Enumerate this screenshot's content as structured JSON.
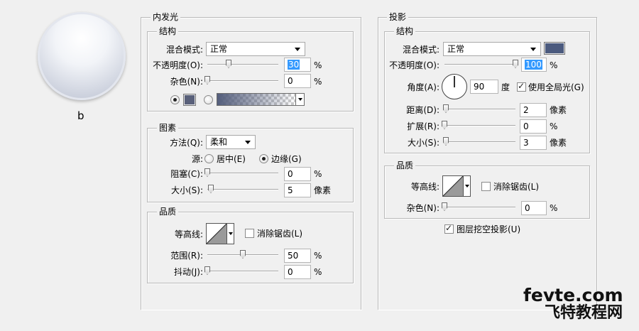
{
  "preview": {
    "label": "b"
  },
  "inner_glow": {
    "title": "内发光",
    "structure": {
      "title": "结构",
      "blend_mode_label": "混合模式:",
      "blend_mode_value": "正常",
      "opacity_label": "不透明度(O):",
      "opacity_value": "30",
      "opacity_unit": "%",
      "noise_label": "杂色(N):",
      "noise_value": "0",
      "noise_unit": "%",
      "color": "#59607a"
    },
    "elements": {
      "title": "图素",
      "method_label": "方法(Q):",
      "method_value": "柔和",
      "source_label": "源:",
      "source_center_label": "居中(E)",
      "source_edge_label": "边缘(G)",
      "choke_label": "阻塞(C):",
      "choke_value": "0",
      "choke_unit": "%",
      "size_label": "大小(S):",
      "size_value": "5",
      "size_unit": "像素"
    },
    "quality": {
      "title": "品质",
      "contour_label": "等高线:",
      "antialias_label": "消除锯齿(L)",
      "range_label": "范围(R):",
      "range_value": "50",
      "range_unit": "%",
      "jitter_label": "抖动(J):",
      "jitter_value": "0",
      "jitter_unit": "%"
    }
  },
  "drop_shadow": {
    "title": "投影",
    "structure": {
      "title": "结构",
      "blend_mode_label": "混合模式:",
      "blend_mode_value": "正常",
      "color": "#4b5a7e",
      "opacity_label": "不透明度(O):",
      "opacity_value": "100",
      "opacity_unit": "%",
      "angle_label": "角度(A):",
      "angle_value": "90",
      "angle_unit": "度",
      "global_light_label": "使用全局光(G)",
      "distance_label": "距离(D):",
      "distance_value": "2",
      "distance_unit": "像素",
      "spread_label": "扩展(R):",
      "spread_value": "0",
      "spread_unit": "%",
      "size_label": "大小(S):",
      "size_value": "3",
      "size_unit": "像素"
    },
    "quality": {
      "title": "品质",
      "contour_label": "等高线:",
      "antialias_label": "消除锯齿(L)",
      "noise_label": "杂色(N):",
      "noise_value": "0",
      "noise_unit": "%"
    },
    "knockout_label": "图层挖空投影(U)"
  },
  "watermark": {
    "line1": "fevte.com",
    "line2": "飞特教程网"
  }
}
